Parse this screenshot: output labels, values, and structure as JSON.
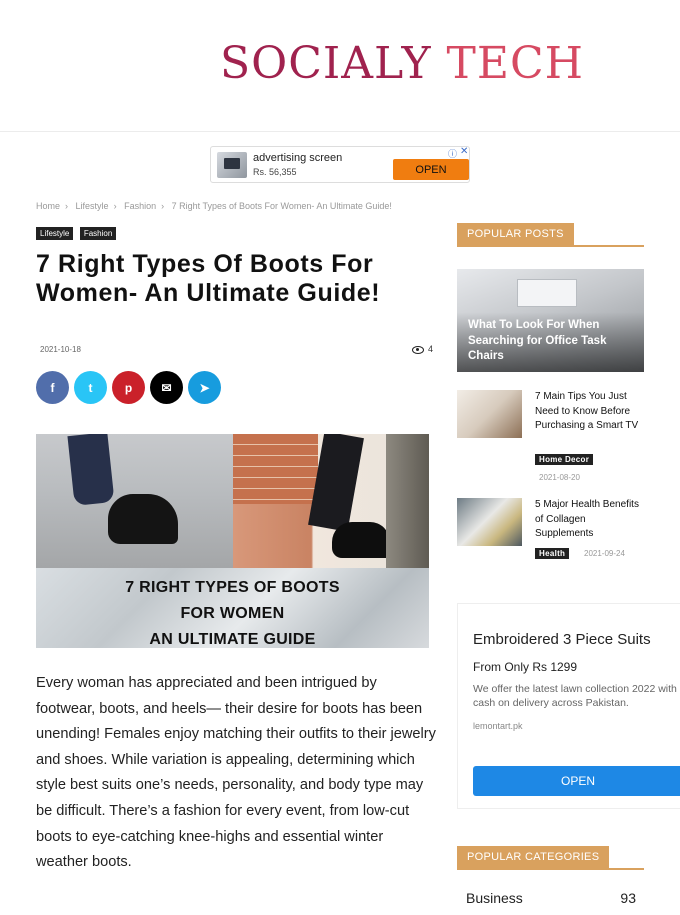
{
  "header": {
    "logo_main": "SOCIALY",
    "logo_accent": "TECH"
  },
  "ad_strip": {
    "title": "advertising screen",
    "price": "Rs. 56,355",
    "button": "OPEN",
    "info_icon": "ⓘ",
    "close_icon": "✕"
  },
  "breadcrumb": [
    "Home",
    "Lifestyle",
    "Fashion",
    "7 Right Types of Boots For Women- An Ultimate Guide!"
  ],
  "article": {
    "tags": [
      "Lifestyle",
      "Fashion"
    ],
    "title": "7 Right Types Of Boots For Women- An Ultimate Guide!",
    "date": "2021-10-18",
    "views": "4",
    "share": [
      {
        "name": "facebook",
        "glyph": "f",
        "color": "#516eab"
      },
      {
        "name": "twitter",
        "glyph": "t",
        "color": "#29c5f6"
      },
      {
        "name": "pinterest",
        "glyph": "p",
        "color": "#ca212a"
      },
      {
        "name": "email",
        "glyph": "✉",
        "color": "#000000"
      },
      {
        "name": "telegram",
        "glyph": "➤",
        "color": "#179cde"
      }
    ],
    "hero_banner": [
      "7 RIGHT TYPES OF BOOTS",
      "FOR WOMEN",
      "AN ULTIMATE GUIDE"
    ],
    "body": "Every woman has appreciated and been intrigued by footwear, boots, and heels— their desire for boots has been unending! Females enjoy matching their outfits to their jewelry and shoes. While variation is appealing, determining which style best suits one’s needs, personality, and body type may be difficult. There’s a fashion for every event, from low-cut boots to eye-catching knee-highs and essential winter weather boots."
  },
  "sidebar": {
    "popular_posts_label": "POPULAR POSTS",
    "main_post": "What To Look For When Searching for Office Task Chairs",
    "posts": [
      {
        "title": "7 Main Tips You Just Need to Know Before Purchasing a Smart TV",
        "category": "Home Decor",
        "date": "2021-08-20"
      },
      {
        "title": "5 Major Health Benefits of Collagen Supplements",
        "category": "Health",
        "date": "2021-09-24"
      }
    ],
    "ad": {
      "title": "Embroidered 3 Piece Suits",
      "subtitle": "From Only Rs 1299",
      "description": "We offer the latest lawn collection 2022 with cash on delivery across Pakistan.",
      "domain": "lemontart.pk",
      "button": "OPEN"
    },
    "popular_categories_label": "POPULAR CATEGORIES",
    "categories": [
      {
        "name": "Business",
        "count": "93"
      }
    ]
  },
  "colors": {
    "accent": "#d9a15e",
    "logo": "#a0224e",
    "ad_button": "#f07d10",
    "open_blue": "#1e88e5"
  }
}
